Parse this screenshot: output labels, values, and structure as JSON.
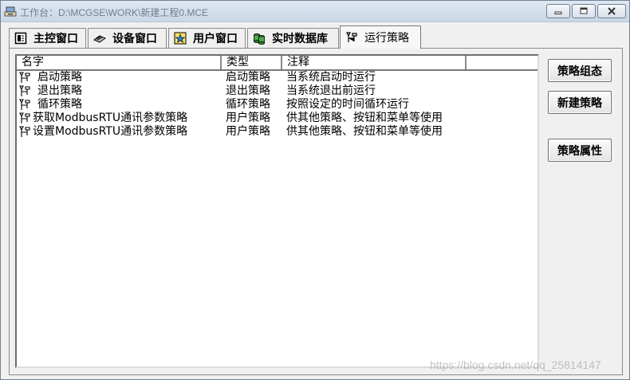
{
  "window": {
    "title": "工作台：D:\\MCGSE\\WORK\\新建工程0.MCE",
    "title_icon": "workbench-icon",
    "controls": [
      "minimize-icon",
      "maximize-icon",
      "close-icon"
    ]
  },
  "tabs": [
    {
      "label": "主控窗口",
      "icon": "main-window-icon"
    },
    {
      "label": "设备窗口",
      "icon": "device-icon"
    },
    {
      "label": "用户窗口",
      "icon": "user-window-icon"
    },
    {
      "label": "实时数据库",
      "icon": "database-icon"
    },
    {
      "label": "运行策略",
      "icon": "strategy-icon",
      "active": true
    }
  ],
  "list": {
    "headers": [
      "名字",
      "类型",
      "注释",
      ""
    ],
    "rows": [
      {
        "name": "启动策略",
        "type": "启动策略",
        "comment": "当系统启动时运行"
      },
      {
        "name": "退出策略",
        "type": "退出策略",
        "comment": "当系统退出前运行"
      },
      {
        "name": "循环策略",
        "type": "循环策略",
        "comment": "按照设定的时间循环运行"
      },
      {
        "name": "获取ModbusRTU通讯参数策略",
        "type": "用户策略",
        "comment": "供其他策略、按钮和菜单等使用"
      },
      {
        "name": "设置ModbusRTU通讯参数策略",
        "type": "用户策略",
        "comment": "供其他策略、按钮和菜单等使用"
      }
    ]
  },
  "buttons": {
    "compose": "策略组态",
    "new": "新建策略",
    "properties": "策略属性"
  },
  "watermark": "https://blog.csdn.net/qq_25814147"
}
